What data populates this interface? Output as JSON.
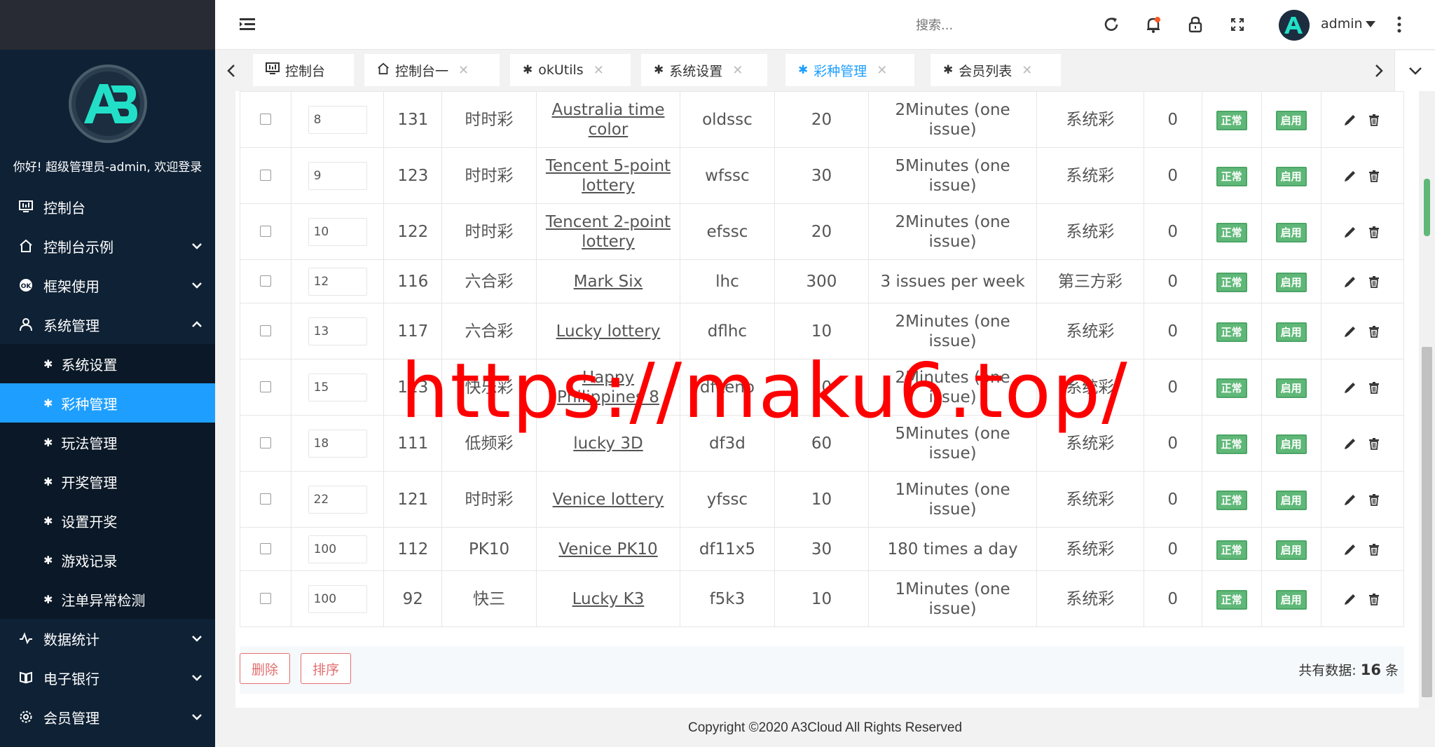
{
  "sidebar": {
    "logo_text": "A3",
    "welcome": "你好! 超级管理员-admin, 欢迎登录",
    "menu": [
      {
        "label": "控制台",
        "icon": "monitor-icon"
      },
      {
        "label": "控制台示例",
        "icon": "home-icon"
      },
      {
        "label": "框架使用",
        "icon": "ok-icon"
      },
      {
        "label": "系统管理",
        "icon": "user-icon"
      }
    ],
    "submenu": [
      {
        "label": "系统设置"
      },
      {
        "label": "彩种管理"
      },
      {
        "label": "玩法管理"
      },
      {
        "label": "开奖管理"
      },
      {
        "label": "设置开奖"
      },
      {
        "label": "游戏记录"
      },
      {
        "label": "注单异常检测"
      }
    ],
    "menu_bottom": [
      {
        "label": "数据统计",
        "icon": "pulse-icon"
      },
      {
        "label": "电子银行",
        "icon": "bank-icon"
      },
      {
        "label": "会员管理",
        "icon": "gear-icon"
      }
    ]
  },
  "header": {
    "search_placeholder": "搜索...",
    "user": "admin"
  },
  "tabs": [
    {
      "label": "控制台"
    },
    {
      "label": "控制台一"
    },
    {
      "label": "okUtils"
    },
    {
      "label": "系统设置"
    },
    {
      "label": "彩种管理"
    },
    {
      "label": "会员列表"
    }
  ],
  "table": {
    "rows": [
      {
        "sort": "8",
        "id": "131",
        "type": "时时彩",
        "name": "Australia time color",
        "code": "oldssc",
        "num": "20",
        "period": "2Minutes (one issue)",
        "source": "系统彩",
        "count": "0",
        "status": "正常",
        "enabled": "启用"
      },
      {
        "sort": "9",
        "id": "123",
        "type": "时时彩",
        "name": "Tencent 5-point lottery",
        "code": "wfssc",
        "num": "30",
        "period": "5Minutes (one issue)",
        "source": "系统彩",
        "count": "0",
        "status": "正常",
        "enabled": "启用"
      },
      {
        "sort": "10",
        "id": "122",
        "type": "时时彩",
        "name": "Tencent 2-point lottery",
        "code": "efssc",
        "num": "20",
        "period": "2Minutes (one issue)",
        "source": "系统彩",
        "count": "0",
        "status": "正常",
        "enabled": "启用"
      },
      {
        "sort": "12",
        "id": "116",
        "type": "六合彩",
        "name": "Mark Six",
        "code": "lhc",
        "num": "300",
        "period": "3 issues per week",
        "source": "第三方彩",
        "count": "0",
        "status": "正常",
        "enabled": "启用"
      },
      {
        "sort": "13",
        "id": "117",
        "type": "六合彩",
        "name": "Lucky lottery",
        "code": "dflhc",
        "num": "10",
        "period": "2Minutes (one issue)",
        "source": "系统彩",
        "count": "0",
        "status": "正常",
        "enabled": "启用"
      },
      {
        "sort": "15",
        "id": "113",
        "type": "快乐彩",
        "name": "Happy Philippines 8",
        "code": "dfkeno",
        "num": "10",
        "period": "2Minutes (one issue)",
        "source": "系统彩",
        "count": "0",
        "status": "正常",
        "enabled": "启用"
      },
      {
        "sort": "18",
        "id": "111",
        "type": "低频彩",
        "name": "lucky 3D",
        "code": "df3d",
        "num": "60",
        "period": "5Minutes (one issue)",
        "source": "系统彩",
        "count": "0",
        "status": "正常",
        "enabled": "启用"
      },
      {
        "sort": "22",
        "id": "121",
        "type": "时时彩",
        "name": "Venice lottery",
        "code": "yfssc",
        "num": "10",
        "period": "1Minutes (one issue)",
        "source": "系统彩",
        "count": "0",
        "status": "正常",
        "enabled": "启用"
      },
      {
        "sort": "100",
        "id": "112",
        "type": "PK10",
        "name": "Venice PK10",
        "code": "df11x5",
        "num": "30",
        "period": "180 times a day",
        "source": "系统彩",
        "count": "0",
        "status": "正常",
        "enabled": "启用"
      },
      {
        "sort": "100",
        "id": "92",
        "type": "快三",
        "name": "Lucky K3",
        "code": "f5k3",
        "num": "10",
        "period": "1Minutes (one issue)",
        "source": "系统彩",
        "count": "0",
        "status": "正常",
        "enabled": "启用"
      }
    ]
  },
  "footer": {
    "delete_label": "删除",
    "sort_label": "排序",
    "total_prefix": "共有数据:",
    "total_count": "16",
    "total_suffix": "条"
  },
  "copyright": "Copyright ©2020 A3Cloud All Rights Reserved",
  "watermark": "https://maku6.top/",
  "colors": {
    "sidebar_bg": "#0f2135",
    "active_blue": "#1e9fff",
    "badge_green": "#5fb878",
    "button_red": "#e26e6e",
    "watermark_red": "#ff0000"
  }
}
